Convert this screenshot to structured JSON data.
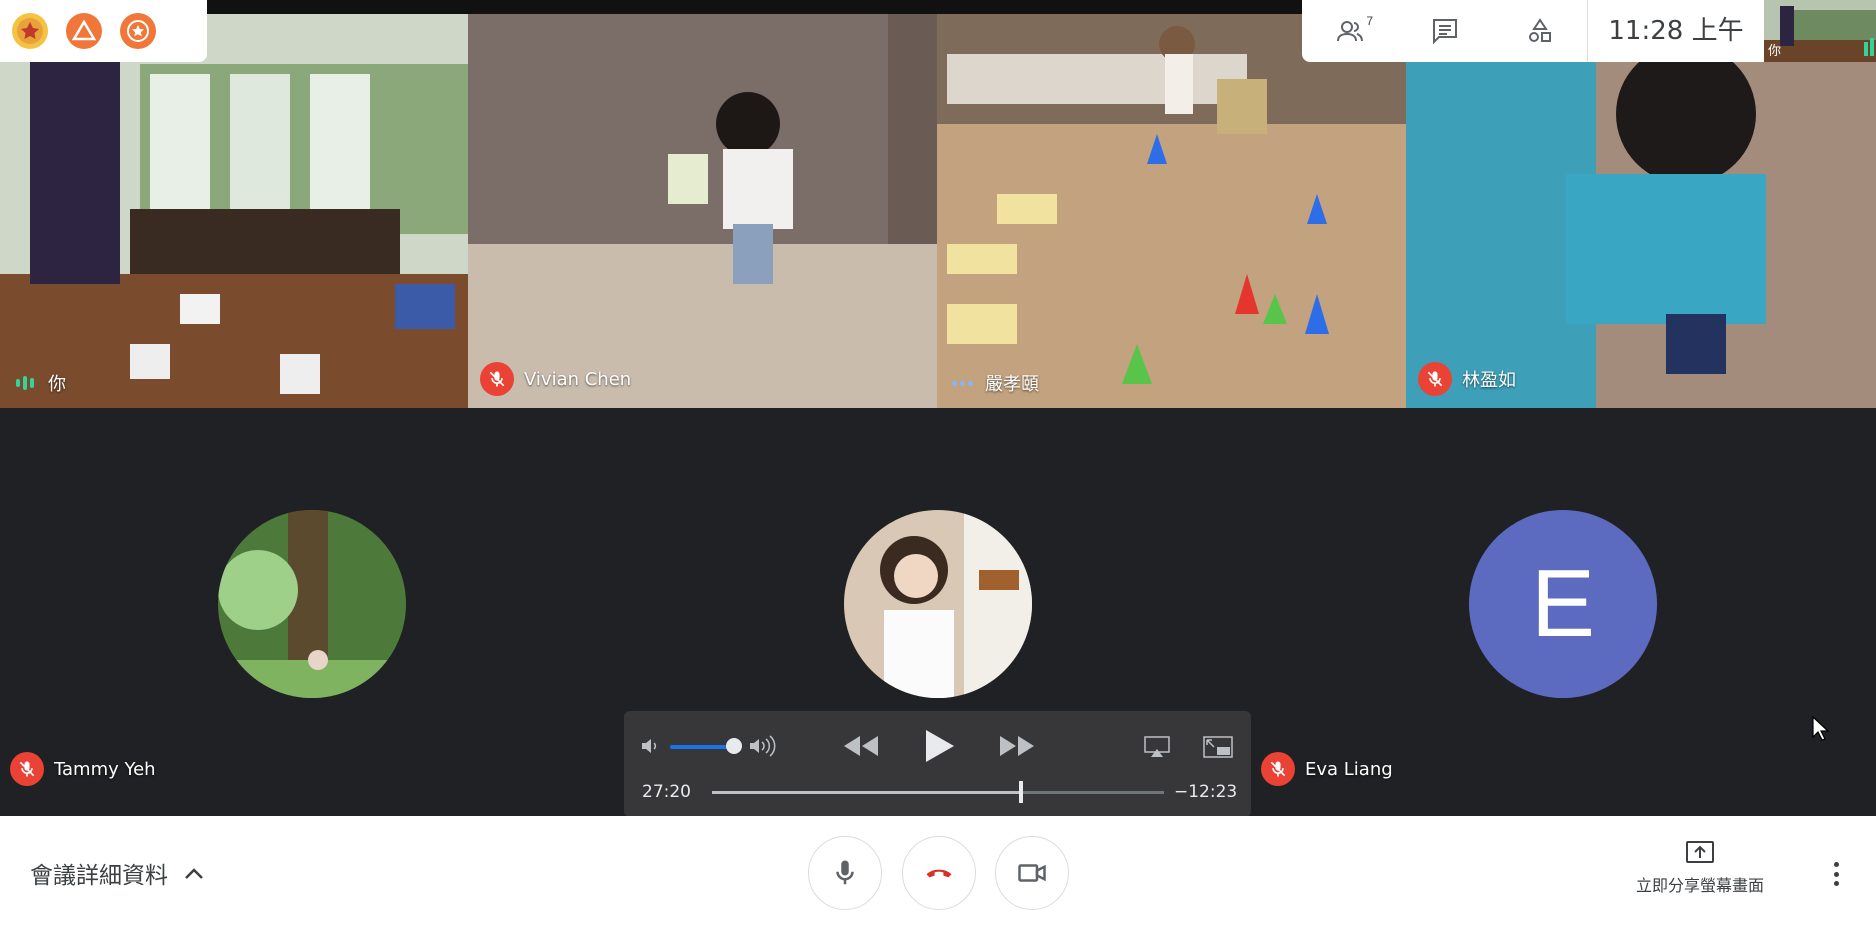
{
  "top_bar": {
    "participants_count": "7",
    "clock": "11:28 上午",
    "self_label": "你"
  },
  "tiles": [
    {
      "name": "你",
      "status": "speaking"
    },
    {
      "name": "Vivian Chen",
      "status": "muted"
    },
    {
      "name": "嚴孝頤",
      "status": "active"
    },
    {
      "name": "林盈如",
      "status": "muted"
    }
  ],
  "lower_tiles": [
    {
      "name": "Tammy Yeh",
      "status": "muted"
    },
    {
      "name": "",
      "status": "none"
    },
    {
      "name": "Eva Liang",
      "status": "muted",
      "avatar_letter": "E"
    }
  ],
  "media_player": {
    "elapsed": "27:20",
    "remaining": "−12:23",
    "progress": 0.683,
    "volume": 0.85
  },
  "bottom_bar": {
    "meeting_details_label": "會議詳細資料",
    "share_label": "立即分享螢幕畫面"
  },
  "colors": {
    "accent": "#1a73e8",
    "muted_red": "#ea4335",
    "avatar_bg": "#5c6bc0",
    "background": "#202124"
  }
}
